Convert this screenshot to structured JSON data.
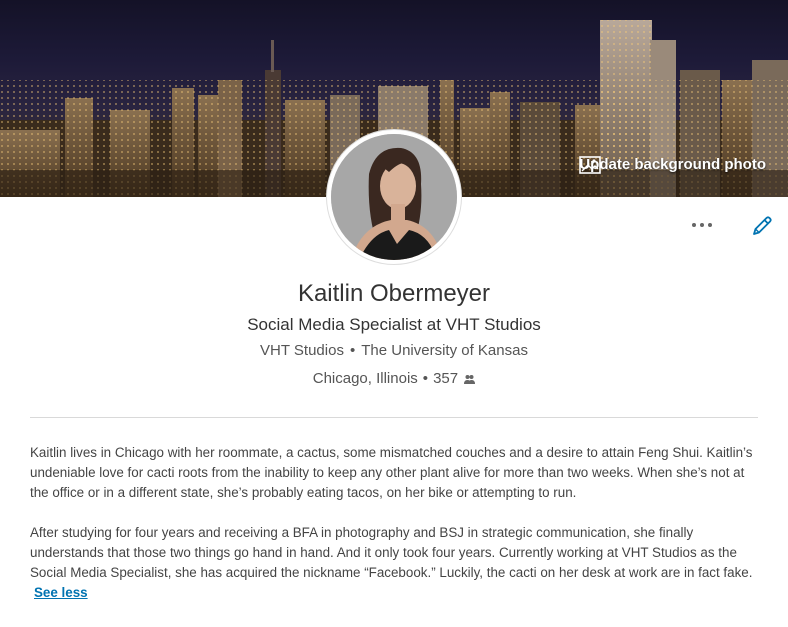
{
  "profile": {
    "update_bg_label": "Update background photo",
    "name": "Kaitlin Obermeyer",
    "headline": "Social Media Specialist at VHT Studios",
    "company": "VHT Studios",
    "school": "The University of Kansas",
    "separator": "•",
    "location": "Chicago, Illinois",
    "connections": "357"
  },
  "summary": {
    "paragraph1": "Kaitlin lives in Chicago with her roommate, a cactus, some mismatched couches and a desire to attain Feng Shui. Kaitlin’s undeniable love for cacti roots from the inability to keep any other plant alive for more than two weeks. When she’s not at the office or in a different state, she’s probably eating tacos, on her bike or attempting to run.",
    "paragraph2": "After studying for four years and receiving a BFA in photography and BSJ in strategic communication, she finally understands that those two things go hand in hand. And it only took four years. Currently working at VHT Studios as the Social Media Specialist, she has acquired the nickname “Facebook.” Luckily, the cacti on her desk at work are in fact fake.",
    "see_less_label": "See less"
  },
  "icons": {
    "more": "more-horizontal-icon",
    "edit": "pencil-icon",
    "photo": "image-icon",
    "connections": "people-icon"
  },
  "colors": {
    "link": "#0073b1",
    "edit_icon": "#0073b1"
  }
}
